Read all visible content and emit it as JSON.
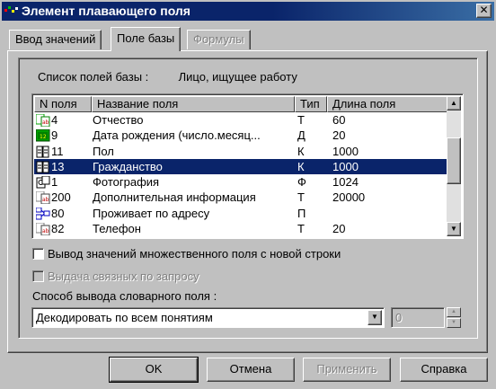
{
  "window": {
    "title": "Элемент плавающего поля",
    "close_glyph": "✕"
  },
  "tabs": [
    {
      "label": "Ввод значений",
      "state": "normal"
    },
    {
      "label": "Поле базы",
      "state": "active"
    },
    {
      "label": "Формулы",
      "state": "disabled"
    }
  ],
  "field_list": {
    "label": "Список полей базы :",
    "value": "Лицо, ищущее работу"
  },
  "table": {
    "columns": [
      "N поля",
      "Название поля",
      "Тип",
      "Длина поля"
    ],
    "rows": [
      {
        "num": "4",
        "name": "Отчество",
        "type": "Т",
        "length": "60",
        "icon": "text-field-icon"
      },
      {
        "num": "9",
        "name": "Дата рождения (число.месяц...",
        "type": "Д",
        "length": "20",
        "icon": "date-field-icon"
      },
      {
        "num": "11",
        "name": "Пол",
        "type": "К",
        "length": "1000",
        "icon": "dictionary-field-icon"
      },
      {
        "num": "13",
        "name": "Гражданство",
        "type": "К",
        "length": "1000",
        "icon": "dictionary-field-icon",
        "selected": true
      },
      {
        "num": "1",
        "name": "Фотография",
        "type": "Ф",
        "length": "1024",
        "icon": "photo-field-icon"
      },
      {
        "num": "200",
        "name": "Дополнительная информация",
        "type": "Т",
        "length": "20000",
        "icon": "attachment-field-icon"
      },
      {
        "num": "80",
        "name": "Проживает по адресу",
        "type": "П",
        "length": "",
        "icon": "link-field-icon"
      },
      {
        "num": "82",
        "name": "Телефон",
        "type": "Т",
        "length": "20",
        "icon": "text-field-icon"
      }
    ]
  },
  "options": {
    "multi_value_newline": {
      "label": "Вывод значений множественного поля с новой строки",
      "checked": false
    },
    "linked_on_request": {
      "label": "Выдача связных по запросу",
      "checked": false,
      "disabled": true
    }
  },
  "dictionary_output": {
    "label": "Способ вывода словарного поля :",
    "selected": "Декодировать по всем понятиям"
  },
  "spinner": {
    "value": "0"
  },
  "buttons": {
    "ok": "OK",
    "cancel": "Отмена",
    "apply": "Применить",
    "help": "Справка"
  }
}
